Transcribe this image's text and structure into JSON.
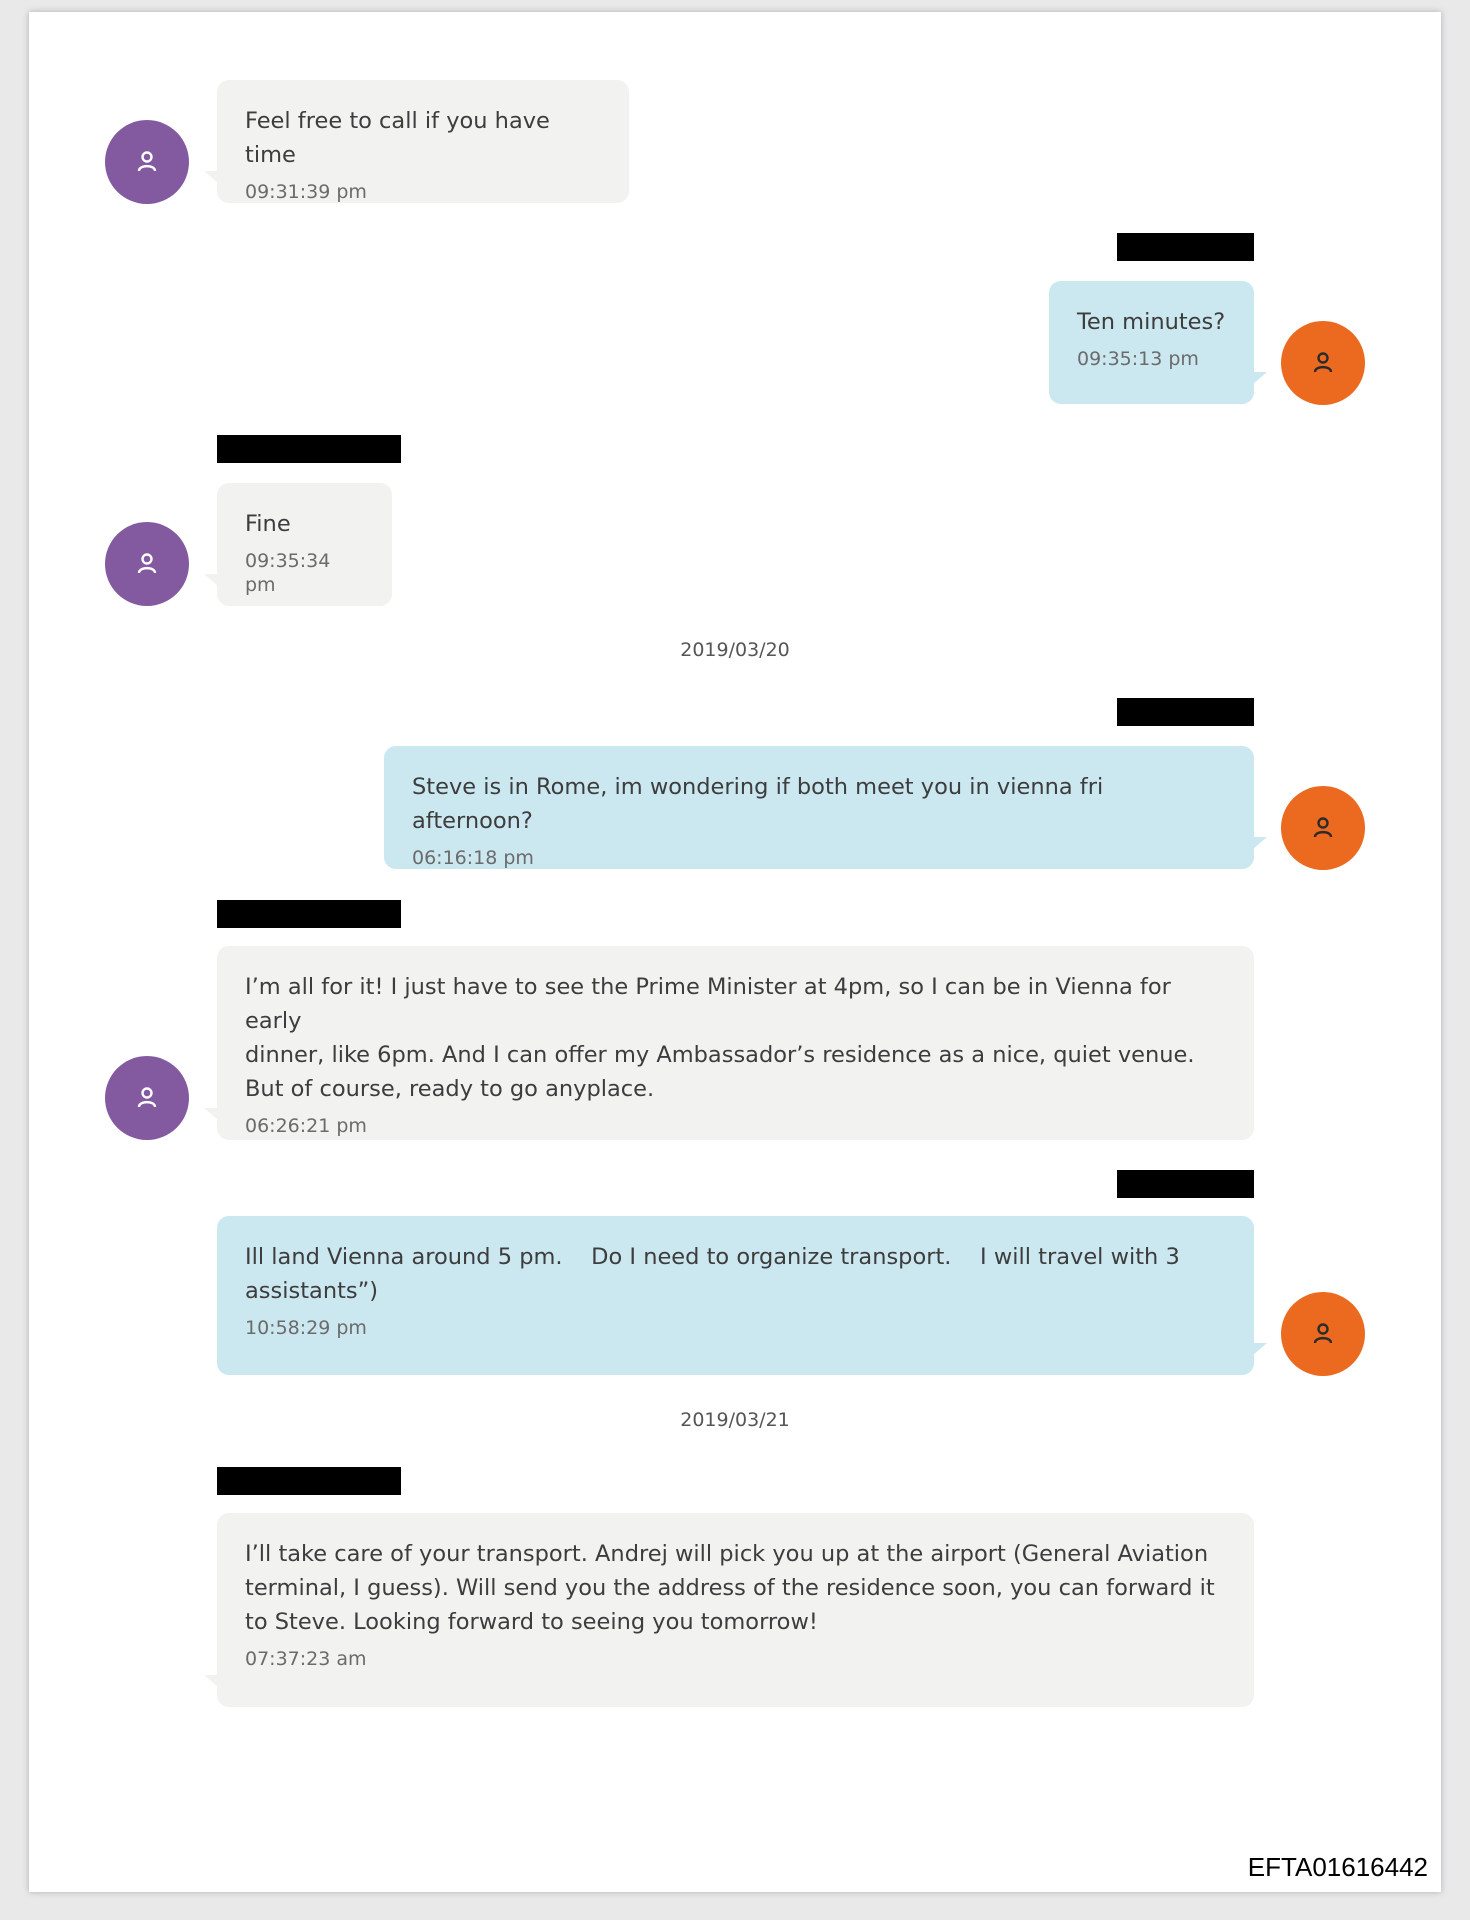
{
  "messages": [
    {
      "text": "Feel free to call if you have time",
      "time": "09:31:39 pm"
    },
    {
      "text": "Ten minutes?",
      "time": "09:35:13 pm"
    },
    {
      "text": "Fine",
      "time": "09:35:34 pm"
    },
    {
      "text": "Steve is in Rome, im wondering if both meet you in vienna fri afternoon?",
      "time": "06:16:18 pm"
    },
    {
      "text": "I’m all for it! I just have to see the Prime Minister at 4pm, so I can be in Vienna for early\ndinner, like 6pm. And I can offer my Ambassador’s residence as a nice, quiet venue.\nBut of course, ready to go anyplace.",
      "time": "06:26:21 pm"
    },
    {
      "text": "Ill land Vienna around 5 pm.    Do I need to organize transport.    I will travel with 3\nassistants”)",
      "time": "10:58:29 pm"
    },
    {
      "text": "I’ll take care of your transport. Andrej will pick you up at the airport (General Aviation\nterminal, I guess). Will send you the address of the residence soon, you can forward it\nto Steve. Looking forward to seeing you tomorrow!",
      "time": "07:37:23 am"
    }
  ],
  "dates": [
    "2019/03/20",
    "2019/03/21"
  ],
  "footer": {
    "doc_id": "EFTA01616442"
  },
  "colors": {
    "incoming_bubble": "#f2f2f0",
    "outgoing_bubble": "#cbe7f0",
    "incoming_avatar": "#835aa0",
    "outgoing_avatar": "#eb6a1f",
    "redaction": "#000000"
  },
  "icons": {
    "avatar": "person-icon"
  }
}
